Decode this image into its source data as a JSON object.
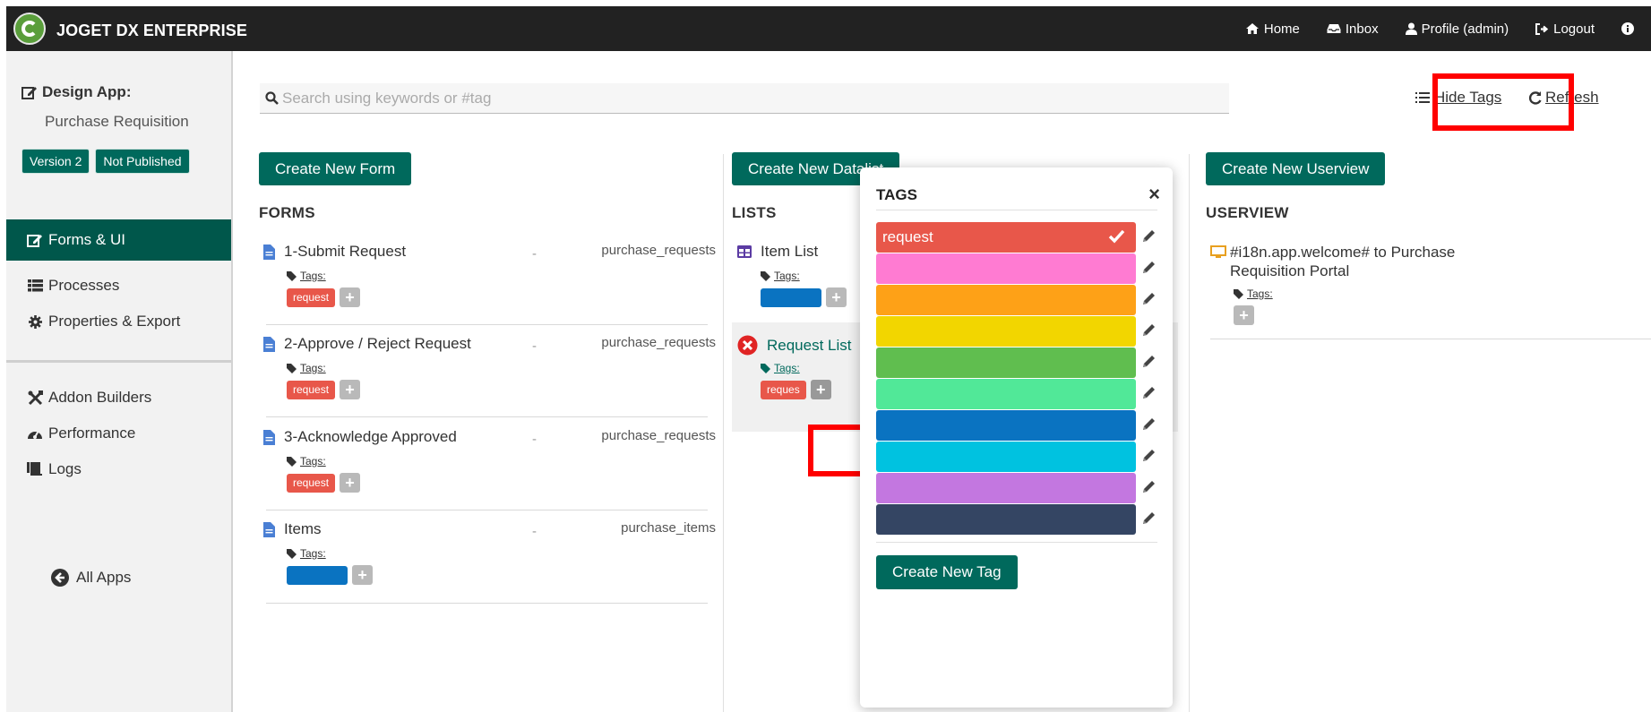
{
  "app": {
    "brand": "JOGET DX ENTERPRISE",
    "topnav": [
      {
        "label": "Home",
        "icon": "home-icon"
      },
      {
        "label": "Inbox",
        "icon": "inbox-icon"
      },
      {
        "label": "Profile (admin)",
        "icon": "user-icon"
      },
      {
        "label": "Logout",
        "icon": "logout-icon"
      }
    ]
  },
  "sidebar": {
    "design_label": "Design App:",
    "app_name": "Purchase Requisition",
    "version_badge": "Version 2",
    "status_badge": "Not Published",
    "items": [
      {
        "label": "Forms & UI",
        "icon": "edit-icon",
        "active": true
      },
      {
        "label": "Processes",
        "icon": "list-icon"
      },
      {
        "label": "Properties & Export",
        "icon": "gear-icon"
      },
      {
        "label": "Addon Builders",
        "icon": "tools-icon"
      },
      {
        "label": "Performance",
        "icon": "gauge-icon"
      },
      {
        "label": "Logs",
        "icon": "scroll-icon"
      }
    ],
    "all_apps": "All Apps"
  },
  "toolbar": {
    "search_placeholder": "Search using keywords or #tag",
    "hide_tags": "Hide Tags",
    "refresh": "Refresh"
  },
  "forms": {
    "create_button": "Create New Form",
    "heading": "FORMS",
    "tags_label": "Tags:",
    "rows": [
      {
        "title": "1-Submit Request",
        "dash": "-",
        "table": "purchase_requests",
        "tag": "request",
        "tag_color": "#e8574a"
      },
      {
        "title": "2-Approve / Reject Request",
        "dash": "-",
        "table": "purchase_requests",
        "tag": "request",
        "tag_color": "#e8574a"
      },
      {
        "title": "3-Acknowledge Approved",
        "dash": "-",
        "table": "purchase_requests",
        "tag": "request",
        "tag_color": "#e8574a"
      },
      {
        "title": "Items",
        "dash": "-",
        "table": "purchase_items",
        "tag": "",
        "tag_color": "#0a73c1"
      }
    ]
  },
  "lists": {
    "create_button": "Create New Datalist",
    "heading": "LISTS",
    "tags_label": "Tags:",
    "rows": [
      {
        "title": "Item List",
        "tag": "",
        "tag_color": "#0a73c1"
      },
      {
        "title": "Request List",
        "tag": "reques",
        "tag_color": "#e8574a"
      }
    ]
  },
  "userview": {
    "create_button": "Create New Userview",
    "heading": "USERVIEW",
    "tags_label": "Tags:",
    "rows": [
      {
        "title_line1": "#i18n.app.welcome# to Purchase",
        "title_line2": "Requisition Portal"
      }
    ]
  },
  "tags_popup": {
    "title": "TAGS",
    "close": "×",
    "options": [
      {
        "label": "request",
        "color": "#e8574a",
        "selected": true
      },
      {
        "label": "",
        "color": "#ff7bd2",
        "selected": false
      },
      {
        "label": "",
        "color": "#fea117",
        "selected": false
      },
      {
        "label": "",
        "color": "#f2d600",
        "selected": false
      },
      {
        "label": "",
        "color": "#60be4f",
        "selected": false
      },
      {
        "label": "",
        "color": "#51e898",
        "selected": false
      },
      {
        "label": "",
        "color": "#0a73c1",
        "selected": false
      },
      {
        "label": "",
        "color": "#00c2e0",
        "selected": false
      },
      {
        "label": "",
        "color": "#c377e0",
        "selected": false
      },
      {
        "label": "",
        "color": "#344563",
        "selected": false
      }
    ],
    "create_button": "Create New Tag"
  },
  "colors": {
    "topbar": "#222222",
    "primary": "#00695c",
    "highlight": "#ff0000"
  }
}
